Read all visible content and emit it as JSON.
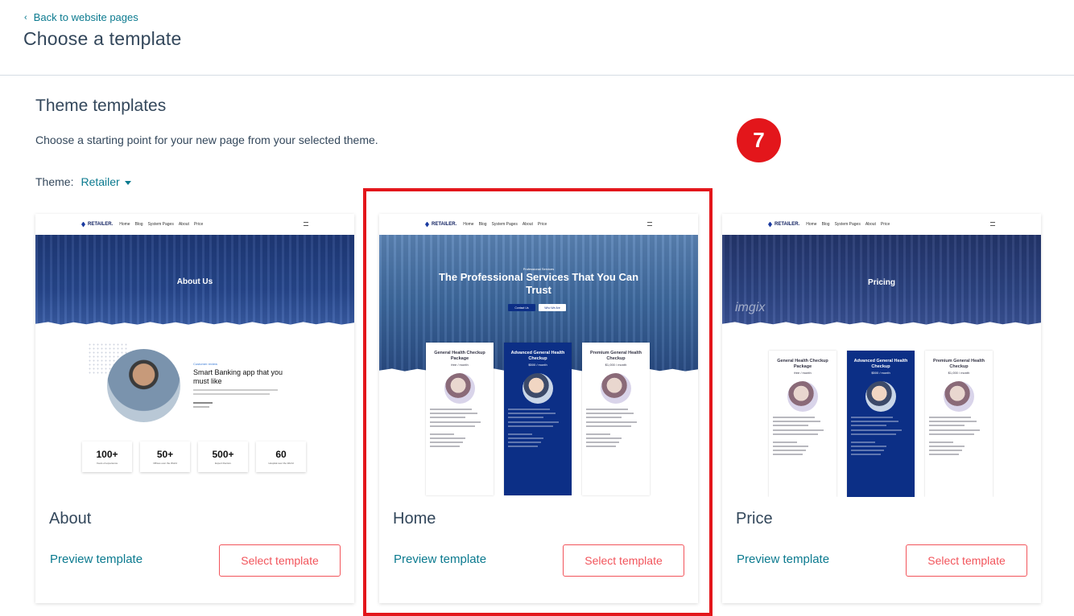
{
  "header": {
    "back_label": "Back to website pages",
    "page_title": "Choose a template"
  },
  "section": {
    "title": "Theme templates",
    "description": "Choose a starting point for your new page from your selected theme.",
    "theme_label": "Theme:",
    "theme_value": "Retailer"
  },
  "step_badge": "7",
  "cards": [
    {
      "title": "About",
      "preview_label": "Preview template",
      "select_label": "Select template",
      "thumb": {
        "brand": "RETAILER.",
        "nav_items": [
          "Home",
          "Blog",
          "System Pages",
          "About",
          "Price"
        ],
        "hero_text": "About Us",
        "eyebrow": "Customer review",
        "headline": "Smart Banking app that you must like",
        "stats": [
          {
            "num": "100+",
            "sub": "Years of experience"
          },
          {
            "num": "50+",
            "sub": "Offices over the World"
          },
          {
            "num": "500+",
            "sub": "Expert Doctors"
          },
          {
            "num": "60",
            "sub": "Hospital over the World"
          }
        ]
      }
    },
    {
      "title": "Home",
      "preview_label": "Preview template",
      "select_label": "Select template",
      "thumb": {
        "brand": "RETAILER.",
        "nav_items": [
          "Home",
          "Blog",
          "System Pages",
          "About",
          "Price"
        ],
        "eyebrow": "Professional Services",
        "hero_text": "The Professional Services That You Can Trust",
        "btn_contact": "Contact Us",
        "btn_join": "Who We Are",
        "plans": [
          {
            "title": "General Health Checkup Package",
            "price": "free / month"
          },
          {
            "title": "Advanced General Health Checkup",
            "price": "$500 / month"
          },
          {
            "title": "Premium General Health Checkup",
            "price": "$1,000 / month"
          }
        ]
      }
    },
    {
      "title": "Price",
      "preview_label": "Preview template",
      "select_label": "Select template",
      "thumb": {
        "brand": "RETAILER.",
        "nav_items": [
          "Home",
          "Blog",
          "System Pages",
          "About",
          "Price"
        ],
        "hero_text": "Pricing",
        "watermark": "imgix",
        "plans": [
          {
            "title": "General Health Checkup Package",
            "price": "free / month"
          },
          {
            "title": "Advanced General Health Checkup",
            "price": "$500 / month"
          },
          {
            "title": "Premium General Health Checkup",
            "price": "$1,000 / month"
          }
        ]
      }
    }
  ],
  "colors": {
    "link": "#0b7a8f",
    "accent_red": "#e3161b",
    "button_border": "#f2545b",
    "text": "#33475b"
  }
}
